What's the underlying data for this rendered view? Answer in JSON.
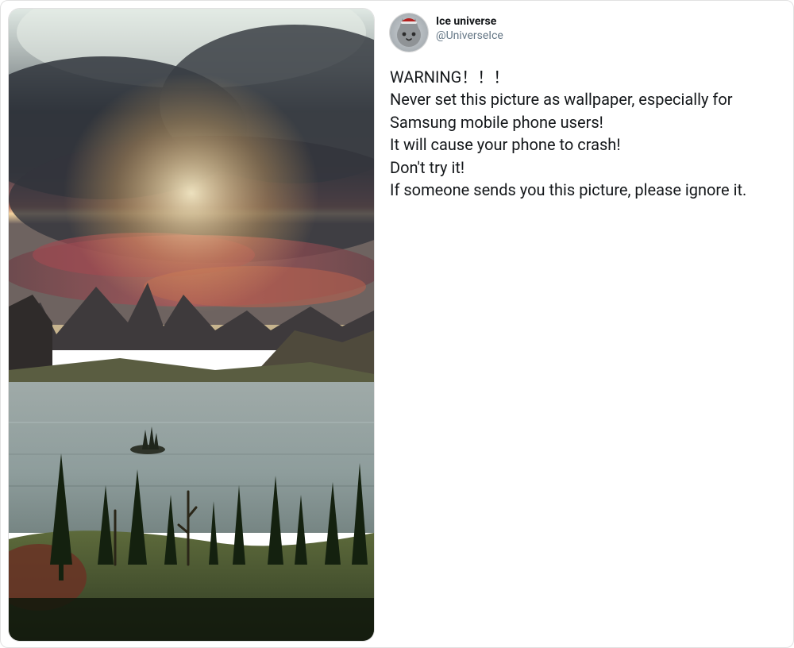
{
  "profile": {
    "display_name": "Ice universe",
    "handle": "@UniverseIce"
  },
  "tweet": {
    "text": "WARNING！！！\nNever set this picture as wallpaper, especially for Samsung mobile phone users!\nIt will cause your phone to crash!\nDon't try it!\nIf someone sends you this picture, please ignore it."
  },
  "media": {
    "alt": "Sunset over a mountain lake with dramatic clouds, dark mountains, a small tree-covered island in the water, and pine trees in the foreground."
  }
}
